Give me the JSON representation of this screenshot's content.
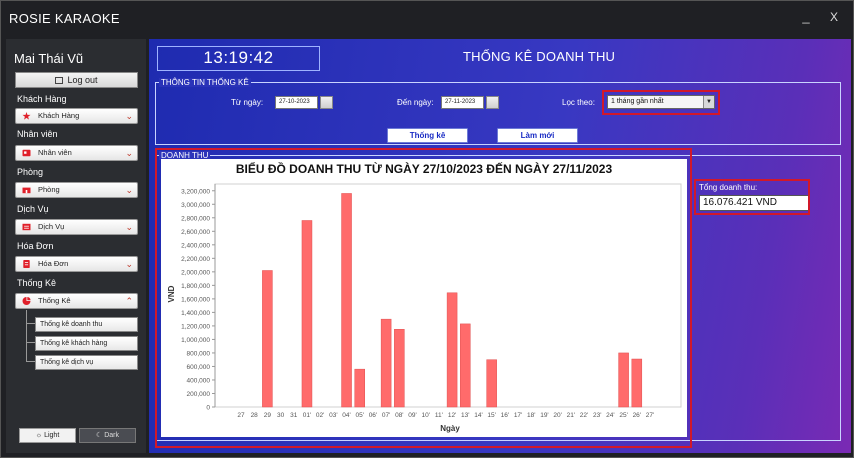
{
  "window": {
    "title": "ROSIE KARAOKE",
    "minimize": "_",
    "close": "X"
  },
  "sidebar": {
    "user_name": "Mai Thái Vũ",
    "logout_label": "Log out",
    "sections": [
      {
        "heading": "Khách Hàng",
        "value": "Khách Hàng",
        "icon": "star-icon",
        "expanded": false
      },
      {
        "heading": "Nhân viên",
        "value": "Nhân viên",
        "icon": "employee-card-icon",
        "expanded": false
      },
      {
        "heading": "Phòng",
        "value": "Phòng",
        "icon": "room-icon",
        "expanded": false
      },
      {
        "heading": "Dịch Vụ",
        "value": "Dịch Vụ",
        "icon": "service-list-icon",
        "expanded": false
      },
      {
        "heading": "Hóa Đơn",
        "value": "Hóa Đơn",
        "icon": "invoice-icon",
        "expanded": false
      },
      {
        "heading": "Thống Kê",
        "value": "Thống Kê",
        "icon": "pie-chart-icon",
        "expanded": true
      }
    ],
    "stats_items": [
      "Thống kê doanh thu",
      "Thống kê khách hàng",
      "Thống kê dịch vụ"
    ],
    "theme": {
      "light_label": "Light",
      "dark_label": "Dark"
    }
  },
  "main": {
    "clock": "13:19:42",
    "title": "THỐNG KÊ DOANH THU",
    "info_group_title": "THÔNG TIN THỐNG KÊ",
    "from_label": "Từ ngày:",
    "from_value": "27-10-2023",
    "to_label": "Đến ngày:",
    "to_value": "27-11-2023",
    "filter_label": "Lọc theo:",
    "filter_value": "1 tháng gần nhất",
    "stats_button": "Thống kê",
    "refresh_button": "Làm mới",
    "revenue_group_title": "DOANH THU",
    "total_label": "Tổng doanh thu:",
    "total_value": "16.076.421 VND"
  },
  "colors": {
    "bar": "#ff6b6b",
    "highlight_outline": "#d1182a",
    "accent_blue": "#1a2cc4"
  },
  "chart_data": {
    "type": "bar",
    "title": "BIỂU ĐỒ DOANH THU TỪ NGÀY 27/10/2023 ĐẾN NGÀY 27/11/2023",
    "xlabel": "Ngày",
    "ylabel": "VND",
    "ylim": [
      0,
      3300000
    ],
    "yticks": [
      0,
      200000,
      400000,
      600000,
      800000,
      1000000,
      1200000,
      1400000,
      1600000,
      1800000,
      2000000,
      2200000,
      2400000,
      2600000,
      2800000,
      3000000,
      3200000
    ],
    "ytick_labels": [
      "0",
      "200,000",
      "400,000",
      "600,000",
      "800,000",
      "1,000,000",
      "1,200,000",
      "1,400,000",
      "1,600,000",
      "1,800,000",
      "2,000,000",
      "2,200,000",
      "2,400,000",
      "2,600,000",
      "2,800,000",
      "3,000,000",
      "3,200,000"
    ],
    "categories": [
      "27",
      "28",
      "29",
      "30",
      "31",
      "01'",
      "02'",
      "03'",
      "04'",
      "05'",
      "06'",
      "07'",
      "08'",
      "09'",
      "10'",
      "11'",
      "12'",
      "13'",
      "14'",
      "15'",
      "16'",
      "17'",
      "18'",
      "19'",
      "20'",
      "21'",
      "22'",
      "23'",
      "24'",
      "25'",
      "26'",
      "27'"
    ],
    "values": [
      0,
      0,
      2020000,
      0,
      0,
      2760000,
      0,
      0,
      3160000,
      560000,
      0,
      1300000,
      1150000,
      0,
      0,
      0,
      1690000,
      1230000,
      0,
      700000,
      0,
      0,
      0,
      0,
      0,
      0,
      0,
      0,
      0,
      800000,
      710000,
      0
    ],
    "grid": false,
    "legend": "none"
  }
}
